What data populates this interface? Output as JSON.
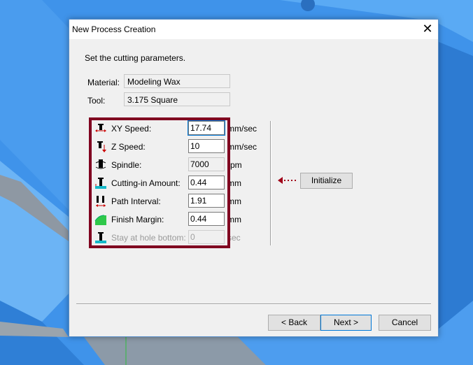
{
  "dialog": {
    "title": "New Process Creation",
    "close_symbol": "✕",
    "instruction": "Set the cutting parameters.",
    "material_label": "Material:",
    "material_value": "Modeling Wax",
    "tool_label": "Tool:",
    "tool_value": "3.175 Square"
  },
  "params": [
    {
      "label": "XY Speed:",
      "value": "17.74",
      "unit": "mm/sec",
      "icon": "xy-speed-icon",
      "state": "selected"
    },
    {
      "label": "Z Speed:",
      "value": "10",
      "unit": "mm/sec",
      "icon": "z-speed-icon",
      "state": "editable"
    },
    {
      "label": "Spindle:",
      "value": "7000",
      "unit": "rpm",
      "icon": "spindle-icon",
      "state": "readonly"
    },
    {
      "label": "Cutting-in Amount:",
      "value": "0.44",
      "unit": "mm",
      "icon": "cutting-in-icon",
      "state": "editable"
    },
    {
      "label": "Path Interval:",
      "value": "1.91",
      "unit": "mm",
      "icon": "path-interval-icon",
      "state": "editable"
    },
    {
      "label": "Finish Margin:",
      "value": "0.44",
      "unit": "mm",
      "icon": "finish-margin-icon",
      "state": "editable"
    },
    {
      "label": "Stay at hole bottom:",
      "value": "0",
      "unit": "sec",
      "icon": "stay-hole-icon",
      "state": "disabled"
    }
  ],
  "buttons": {
    "initialize": "Initialize",
    "back": "< Back",
    "next": "Next >",
    "cancel": "Cancel"
  },
  "colors": {
    "highlight_frame": "#800020",
    "scene_blue": "#3b8fe6",
    "selection": "#0078d7"
  }
}
